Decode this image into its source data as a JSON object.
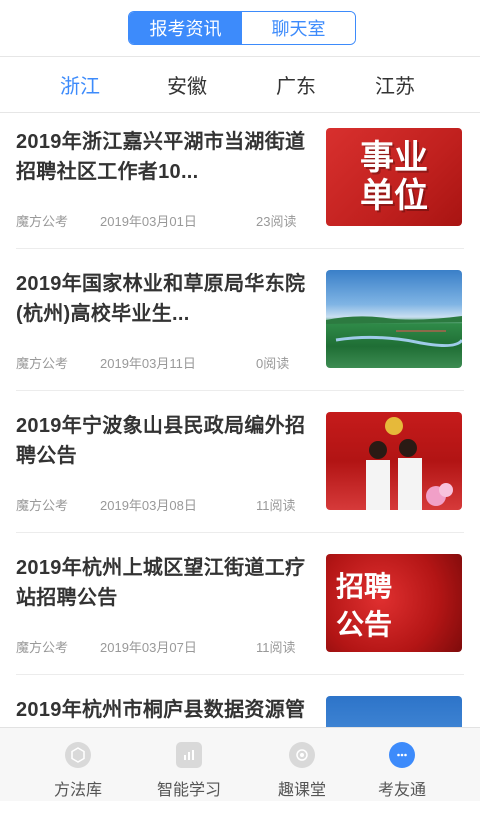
{
  "segment": {
    "items": [
      {
        "label": "报考资讯",
        "active": true
      },
      {
        "label": "聊天室",
        "active": false
      }
    ]
  },
  "tabs": [
    {
      "label": "浙江",
      "active": true
    },
    {
      "label": "安徽",
      "active": false
    },
    {
      "label": "广东",
      "active": false
    },
    {
      "label": "江苏",
      "active": false
    }
  ],
  "articles": [
    {
      "title": "2019年浙江嘉兴平湖市当湖街道招聘社区工作者10...",
      "source": "魔方公考",
      "date": "2019年03月01日",
      "reads": "23阅读",
      "thumb": "事业单位"
    },
    {
      "title": "2019年国家林业和草原局华东院(杭州)高校毕业生...",
      "source": "魔方公考",
      "date": "2019年03月11日",
      "reads": "0阅读",
      "thumb": ""
    },
    {
      "title": "2019年宁波象山县民政局编外招聘公告",
      "source": "魔方公考",
      "date": "2019年03月08日",
      "reads": "11阅读",
      "thumb": ""
    },
    {
      "title": "2019年杭州上城区望江街道工疗站招聘公告",
      "source": "魔方公考",
      "date": "2019年03月07日",
      "reads": "11阅读",
      "thumb": "招聘公告"
    },
    {
      "title": "2019年杭州市桐庐县数据资源管",
      "source": "",
      "date": "",
      "reads": "",
      "thumb": ""
    }
  ],
  "bottom_nav": [
    {
      "label": "方法库",
      "icon": "cube-icon",
      "active": false
    },
    {
      "label": "智能学习",
      "icon": "chart-icon",
      "active": false
    },
    {
      "label": "趣课堂",
      "icon": "play-icon",
      "active": false
    },
    {
      "label": "考友通",
      "icon": "chat-bubble-icon",
      "active": true
    }
  ],
  "colors": {
    "accent": "#3d8bfb",
    "text": "#333333",
    "muted": "#999999"
  }
}
